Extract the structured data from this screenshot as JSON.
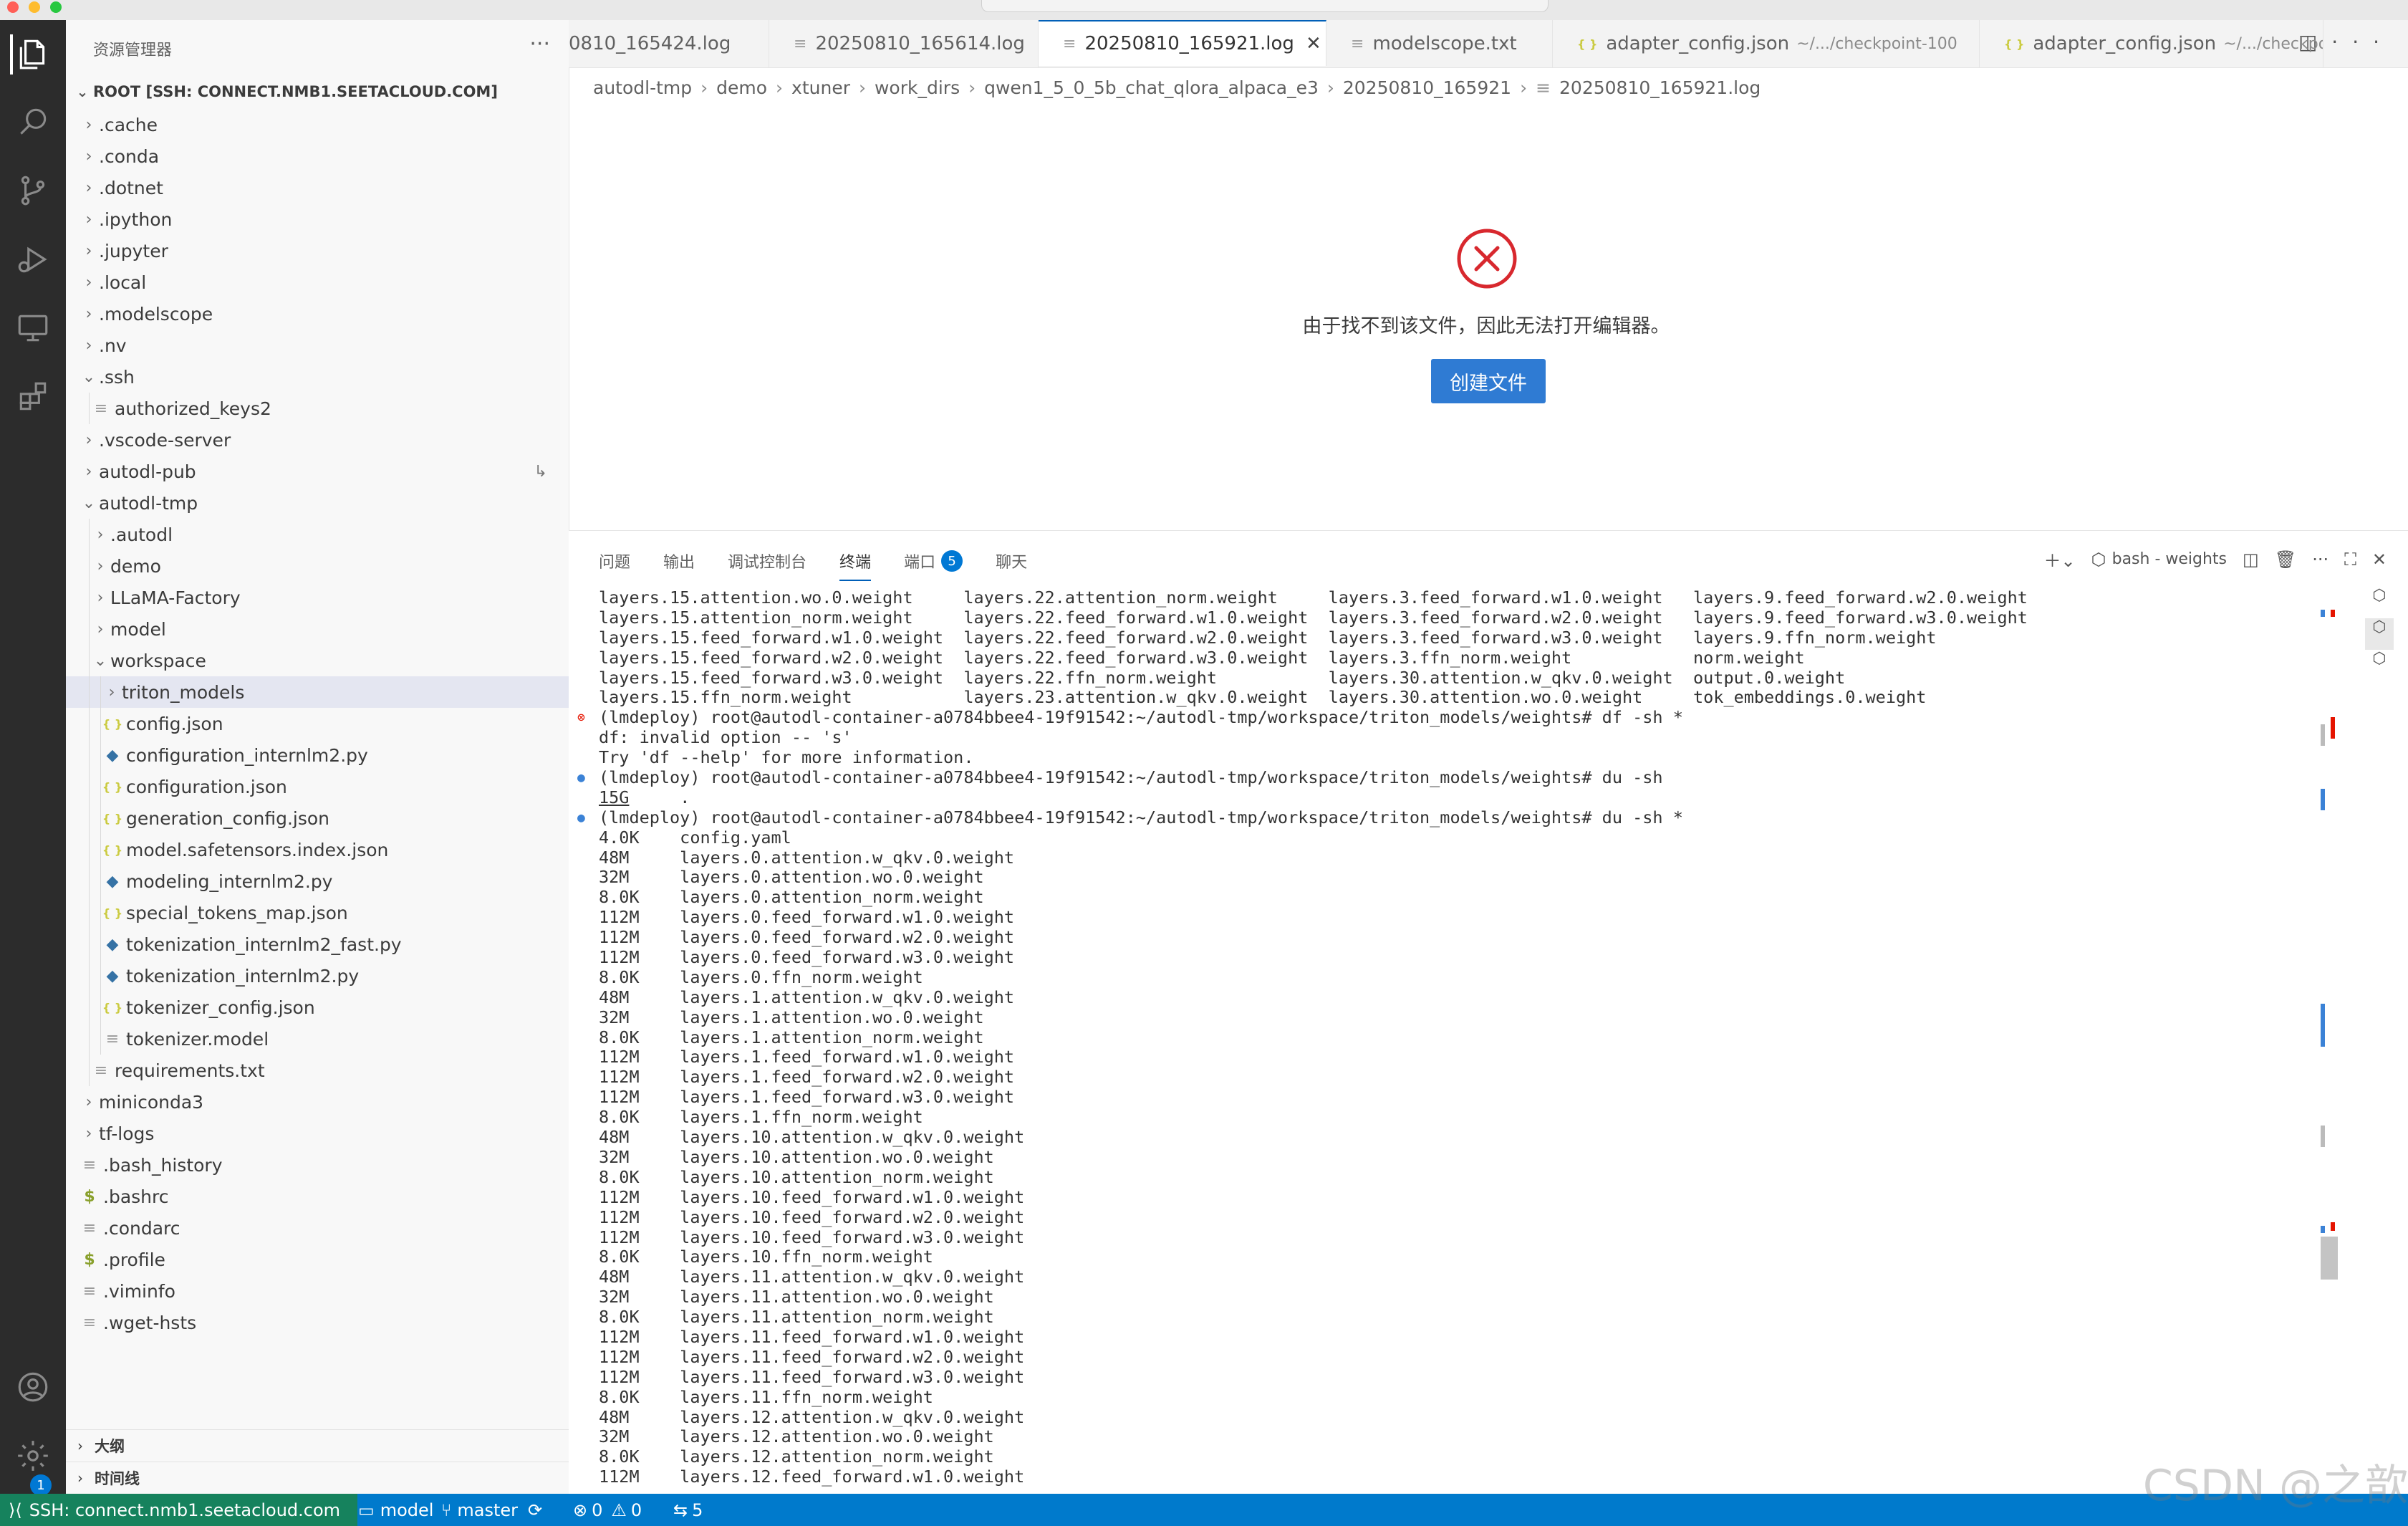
{
  "sidebar": {
    "title": "资源管理器",
    "root": "ROOT [SSH: CONNECT.NMB1.SEETACLOUD.COM]",
    "items": [
      {
        "label": ".cache",
        "type": "folder",
        "depth": 0,
        "open": false
      },
      {
        "label": ".conda",
        "type": "folder",
        "depth": 0,
        "open": false
      },
      {
        "label": ".dotnet",
        "type": "folder",
        "depth": 0,
        "open": false
      },
      {
        "label": ".ipython",
        "type": "folder",
        "depth": 0,
        "open": false
      },
      {
        "label": ".jupyter",
        "type": "folder",
        "depth": 0,
        "open": false
      },
      {
        "label": ".local",
        "type": "folder",
        "depth": 0,
        "open": false
      },
      {
        "label": ".modelscope",
        "type": "folder",
        "depth": 0,
        "open": false
      },
      {
        "label": ".nv",
        "type": "folder",
        "depth": 0,
        "open": false
      },
      {
        "label": ".ssh",
        "type": "folder",
        "depth": 0,
        "open": true
      },
      {
        "label": "authorized_keys2",
        "type": "txt",
        "depth": 1
      },
      {
        "label": ".vscode-server",
        "type": "folder",
        "depth": 0,
        "open": false
      },
      {
        "label": "autodl-pub",
        "type": "folder",
        "depth": 0,
        "open": false,
        "link": true
      },
      {
        "label": "autodl-tmp",
        "type": "folder",
        "depth": 0,
        "open": true
      },
      {
        "label": ".autodl",
        "type": "folder",
        "depth": 1,
        "open": false
      },
      {
        "label": "demo",
        "type": "folder",
        "depth": 1,
        "open": false
      },
      {
        "label": "LLaMA-Factory",
        "type": "folder",
        "depth": 1,
        "open": false
      },
      {
        "label": "model",
        "type": "folder",
        "depth": 1,
        "open": false
      },
      {
        "label": "workspace",
        "type": "folder",
        "depth": 1,
        "open": true
      },
      {
        "label": "triton_models",
        "type": "folder",
        "depth": 2,
        "open": false,
        "selected": true
      },
      {
        "label": "config.json",
        "type": "json",
        "depth": 2
      },
      {
        "label": "configuration_internlm2.py",
        "type": "py",
        "depth": 2
      },
      {
        "label": "configuration.json",
        "type": "json",
        "depth": 2
      },
      {
        "label": "generation_config.json",
        "type": "json",
        "depth": 2
      },
      {
        "label": "model.safetensors.index.json",
        "type": "json",
        "depth": 2
      },
      {
        "label": "modeling_internlm2.py",
        "type": "py",
        "depth": 2
      },
      {
        "label": "special_tokens_map.json",
        "type": "json",
        "depth": 2
      },
      {
        "label": "tokenization_internlm2_fast.py",
        "type": "py",
        "depth": 2
      },
      {
        "label": "tokenization_internlm2.py",
        "type": "py",
        "depth": 2
      },
      {
        "label": "tokenizer_config.json",
        "type": "json",
        "depth": 2
      },
      {
        "label": "tokenizer.model",
        "type": "txt",
        "depth": 2
      },
      {
        "label": "requirements.txt",
        "type": "txt",
        "depth": 1
      },
      {
        "label": "miniconda3",
        "type": "folder",
        "depth": 0,
        "open": false
      },
      {
        "label": "tf-logs",
        "type": "folder",
        "depth": 0,
        "open": false
      },
      {
        "label": ".bash_history",
        "type": "txt",
        "depth": 0
      },
      {
        "label": ".bashrc",
        "type": "sh",
        "depth": 0
      },
      {
        "label": ".condarc",
        "type": "txt",
        "depth": 0
      },
      {
        "label": ".profile",
        "type": "sh",
        "depth": 0
      },
      {
        "label": ".viminfo",
        "type": "txt",
        "depth": 0
      },
      {
        "label": ".wget-hsts",
        "type": "txt",
        "depth": 0
      }
    ],
    "sections": [
      "大纲",
      "时间线"
    ]
  },
  "tabs": [
    {
      "label": "0810_165424.log",
      "icon": "txt",
      "desc": "",
      "active": false
    },
    {
      "label": "20250810_165614.log",
      "icon": "txt",
      "desc": "",
      "active": false
    },
    {
      "label": "20250810_165921.log",
      "icon": "txt",
      "desc": "",
      "active": true
    },
    {
      "label": "modelscope.txt",
      "icon": "txt",
      "desc": "",
      "active": false
    },
    {
      "label": "adapter_config.json",
      "icon": "json",
      "desc": "~/.../checkpoint-100",
      "active": false
    },
    {
      "label": "adapter_config.json",
      "icon": "json",
      "desc": "~/.../checkpoint-",
      "active": false
    }
  ],
  "breadcrumb": [
    "autodl-tmp",
    "demo",
    "xtuner",
    "work_dirs",
    "qwen1_5_0_5b_chat_qlora_alpaca_e3",
    "20250810_165921",
    "20250810_165921.log"
  ],
  "editor": {
    "error_message": "由于找不到该文件，因此无法打开编辑器。",
    "create_button": "创建文件"
  },
  "panel": {
    "tabs": [
      {
        "label": "问题",
        "active": false
      },
      {
        "label": "输出",
        "active": false
      },
      {
        "label": "调试控制台",
        "active": false
      },
      {
        "label": "终端",
        "active": true
      },
      {
        "label": "端口",
        "active": false,
        "badge": "5"
      },
      {
        "label": "聊天",
        "active": false
      }
    ],
    "terminal_name": "bash - weights"
  },
  "terminal": {
    "lines": [
      {
        "text": "layers.15.attention.wo.0.weight     layers.22.attention_norm.weight     layers.3.feed_forward.w1.0.weight   layers.9.feed_forward.w2.0.weight"
      },
      {
        "text": "layers.15.attention_norm.weight     layers.22.feed_forward.w1.0.weight  layers.3.feed_forward.w2.0.weight   layers.9.feed_forward.w3.0.weight"
      },
      {
        "text": "layers.15.feed_forward.w1.0.weight  layers.22.feed_forward.w2.0.weight  layers.3.feed_forward.w3.0.weight   layers.9.ffn_norm.weight"
      },
      {
        "text": "layers.15.feed_forward.w2.0.weight  layers.22.feed_forward.w3.0.weight  layers.3.ffn_norm.weight            norm.weight"
      },
      {
        "text": "layers.15.feed_forward.w3.0.weight  layers.22.ffn_norm.weight           layers.30.attention.w_qkv.0.weight  output.0.weight"
      },
      {
        "text": "layers.15.ffn_norm.weight           layers.23.attention.w_qkv.0.weight  layers.30.attention.wo.0.weight     tok_embeddings.0.weight"
      },
      {
        "text": "(lmdeploy) root@autodl-container-a0784bbee4-19f91542:~/autodl-tmp/workspace/triton_models/weights# df -sh *",
        "mark": "err"
      },
      {
        "text": "df: invalid option -- 's'"
      },
      {
        "text": "Try 'df --help' for more information."
      },
      {
        "text": "(lmdeploy) root@autodl-container-a0784bbee4-19f91542:~/autodl-tmp/workspace/triton_models/weights# du -sh",
        "mark": "ok"
      },
      {
        "text": "15G",
        "rest": "     .",
        "underline": true
      },
      {
        "text": "(lmdeploy) root@autodl-container-a0784bbee4-19f91542:~/autodl-tmp/workspace/triton_models/weights# du -sh *",
        "mark": "ok"
      },
      {
        "text": "4.0K    config.yaml"
      },
      {
        "text": "48M     layers.0.attention.w_qkv.0.weight"
      },
      {
        "text": "32M     layers.0.attention.wo.0.weight"
      },
      {
        "text": "8.0K    layers.0.attention_norm.weight"
      },
      {
        "text": "112M    layers.0.feed_forward.w1.0.weight"
      },
      {
        "text": "112M    layers.0.feed_forward.w2.0.weight"
      },
      {
        "text": "112M    layers.0.feed_forward.w3.0.weight"
      },
      {
        "text": "8.0K    layers.0.ffn_norm.weight"
      },
      {
        "text": "48M     layers.1.attention.w_qkv.0.weight"
      },
      {
        "text": "32M     layers.1.attention.wo.0.weight"
      },
      {
        "text": "8.0K    layers.1.attention_norm.weight"
      },
      {
        "text": "112M    layers.1.feed_forward.w1.0.weight"
      },
      {
        "text": "112M    layers.1.feed_forward.w2.0.weight"
      },
      {
        "text": "112M    layers.1.feed_forward.w3.0.weight"
      },
      {
        "text": "8.0K    layers.1.ffn_norm.weight"
      },
      {
        "text": "48M     layers.10.attention.w_qkv.0.weight"
      },
      {
        "text": "32M     layers.10.attention.wo.0.weight"
      },
      {
        "text": "8.0K    layers.10.attention_norm.weight"
      },
      {
        "text": "112M    layers.10.feed_forward.w1.0.weight"
      },
      {
        "text": "112M    layers.10.feed_forward.w2.0.weight"
      },
      {
        "text": "112M    layers.10.feed_forward.w3.0.weight"
      },
      {
        "text": "8.0K    layers.10.ffn_norm.weight"
      },
      {
        "text": "48M     layers.11.attention.w_qkv.0.weight"
      },
      {
        "text": "32M     layers.11.attention.wo.0.weight"
      },
      {
        "text": "8.0K    layers.11.attention_norm.weight"
      },
      {
        "text": "112M    layers.11.feed_forward.w1.0.weight"
      },
      {
        "text": "112M    layers.11.feed_forward.w2.0.weight"
      },
      {
        "text": "112M    layers.11.feed_forward.w3.0.weight"
      },
      {
        "text": "8.0K    layers.11.ffn_norm.weight"
      },
      {
        "text": "48M     layers.12.attention.w_qkv.0.weight"
      },
      {
        "text": "32M     layers.12.attention.wo.0.weight"
      },
      {
        "text": "8.0K    layers.12.attention_norm.weight"
      },
      {
        "text": "112M    layers.12.feed_forward.w1.0.weight"
      }
    ]
  },
  "statusbar": {
    "remote": "SSH: connect.nmb1.seetacloud.com",
    "env": "model",
    "branch": "master",
    "errors": "0",
    "warnings": "0",
    "ports": "5"
  },
  "activity": {
    "settings_badge": "1"
  },
  "watermark": "CSDN @之歆",
  "colors": {
    "accent": "#007acc",
    "remote": "#16825d",
    "error": "#e51400",
    "activitybar": "#2c2c2c",
    "button": "#2f7bd3"
  }
}
